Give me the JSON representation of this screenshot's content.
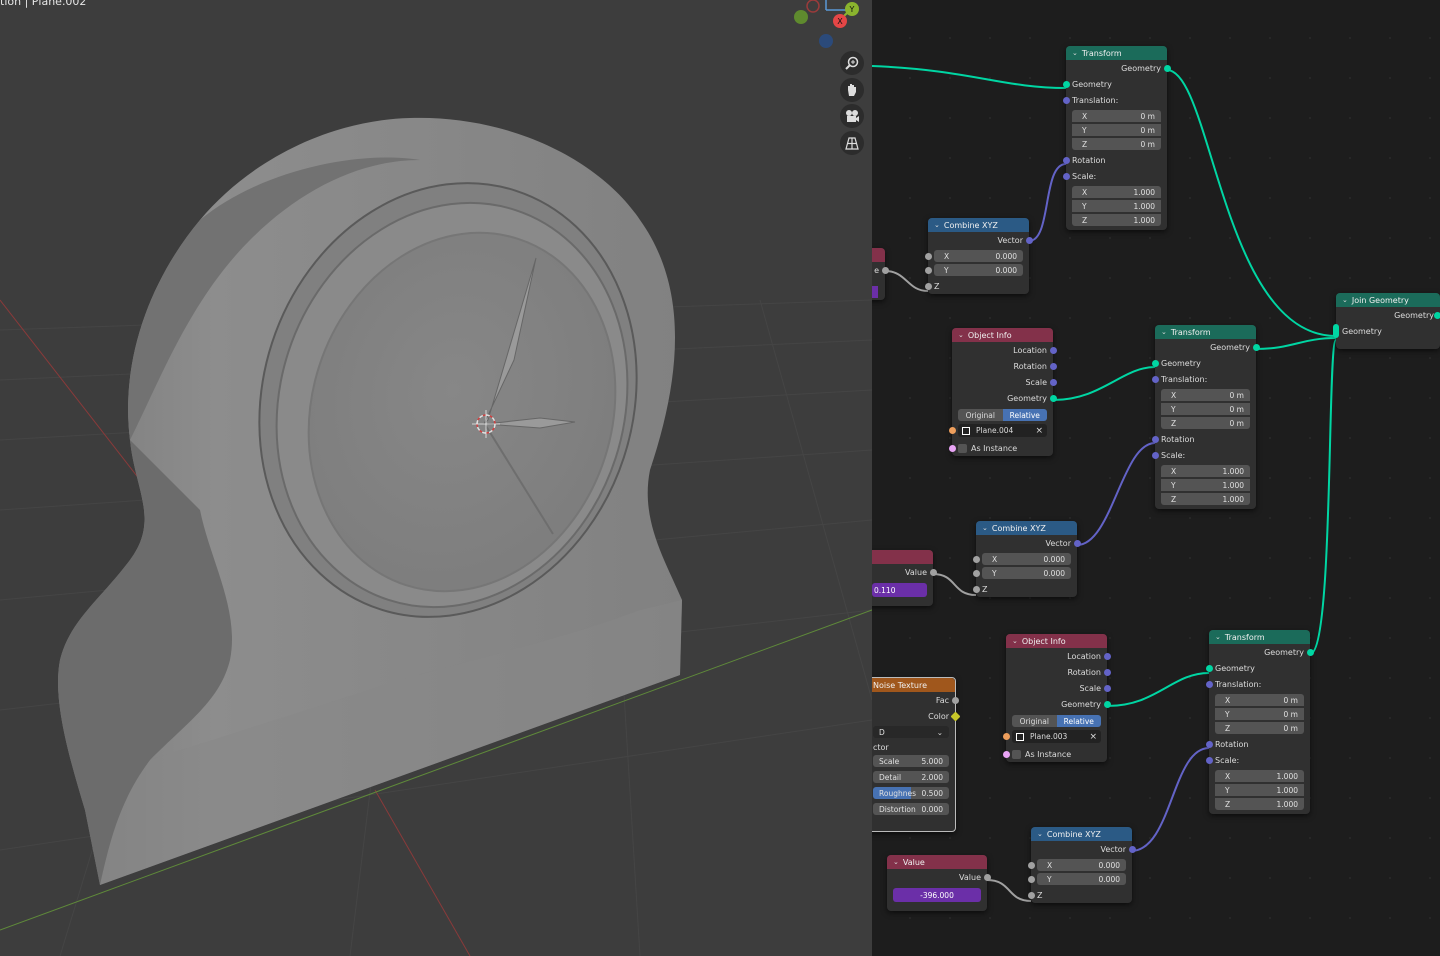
{
  "viewport": {
    "title": "tion | Plane.002",
    "gizmo": {
      "x": "X",
      "y": "Y"
    },
    "tools": [
      {
        "icon": "zoom-icon"
      },
      {
        "icon": "hand-pan-icon"
      },
      {
        "icon": "camera-icon"
      },
      {
        "icon": "grid-view-icon"
      }
    ]
  },
  "colors": {
    "geometry": "#00d6a3",
    "vector": "#6363c7",
    "float": "#a1a1a1",
    "geometry_header": "#1b6b5a",
    "vector_header": "#2b5a85",
    "input_header": "#83314a",
    "texture_header": "#a0571c",
    "accent": "#4772b3",
    "value_field": "#6b2fa8"
  },
  "nodes": {
    "transform1": {
      "title": "Transform",
      "out": "Geometry",
      "in_geometry": "Geometry",
      "translation_label": "Translation:",
      "tx": {
        "k": "X",
        "v": "0 m"
      },
      "ty": {
        "k": "Y",
        "v": "0 m"
      },
      "tz": {
        "k": "Z",
        "v": "0 m"
      },
      "rotation": "Rotation",
      "scale_label": "Scale:",
      "sx": {
        "k": "X",
        "v": "1.000"
      },
      "sy": {
        "k": "Y",
        "v": "1.000"
      },
      "sz": {
        "k": "Z",
        "v": "1.000"
      }
    },
    "transform2": {
      "title": "Transform",
      "out": "Geometry",
      "in_geometry": "Geometry",
      "translation_label": "Translation:",
      "tx": {
        "k": "X",
        "v": "0 m"
      },
      "ty": {
        "k": "Y",
        "v": "0 m"
      },
      "tz": {
        "k": "Z",
        "v": "0 m"
      },
      "rotation": "Rotation",
      "scale_label": "Scale:",
      "sx": {
        "k": "X",
        "v": "1.000"
      },
      "sy": {
        "k": "Y",
        "v": "1.000"
      },
      "sz": {
        "k": "Z",
        "v": "1.000"
      }
    },
    "transform3": {
      "title": "Transform",
      "out": "Geometry",
      "in_geometry": "Geometry",
      "translation_label": "Translation:",
      "tx": {
        "k": "X",
        "v": "0 m"
      },
      "ty": {
        "k": "Y",
        "v": "0 m"
      },
      "tz": {
        "k": "Z",
        "v": "0 m"
      },
      "rotation": "Rotation",
      "scale_label": "Scale:",
      "sx": {
        "k": "X",
        "v": "1.000"
      },
      "sy": {
        "k": "Y",
        "v": "1.000"
      },
      "sz": {
        "k": "Z",
        "v": "1.000"
      }
    },
    "combine1": {
      "title": "Combine XYZ",
      "out": "Vector",
      "x": {
        "k": "X",
        "v": "0.000"
      },
      "y": {
        "k": "Y",
        "v": "0.000"
      },
      "z": "Z"
    },
    "combine2": {
      "title": "Combine XYZ",
      "out": "Vector",
      "x": {
        "k": "X",
        "v": "0.000"
      },
      "y": {
        "k": "Y",
        "v": "0.000"
      },
      "z": "Z"
    },
    "combine3": {
      "title": "Combine XYZ",
      "out": "Vector",
      "x": {
        "k": "X",
        "v": "0.000"
      },
      "y": {
        "k": "Y",
        "v": "0.000"
      },
      "z": "Z"
    },
    "objinfo1": {
      "title": "Object Info",
      "location": "Location",
      "rotation": "Rotation",
      "scale": "Scale",
      "geometry": "Geometry",
      "opt_original": "Original",
      "opt_relative": "Relative",
      "object": "Plane.004",
      "as_instance": "As Instance"
    },
    "objinfo2": {
      "title": "Object Info",
      "location": "Location",
      "rotation": "Rotation",
      "scale": "Scale",
      "geometry": "Geometry",
      "opt_original": "Original",
      "opt_relative": "Relative",
      "object": "Plane.003",
      "as_instance": "As Instance"
    },
    "join": {
      "title": "Join Geometry",
      "out": "Geometry",
      "in": "Geometry"
    },
    "partial1": {
      "label": "e"
    },
    "value_partial": {
      "out": "Value",
      "value": "0.110"
    },
    "value": {
      "title": "Value",
      "out": "Value",
      "value": "-396.000"
    },
    "noise": {
      "title": "Noise Texture",
      "fac": "Fac",
      "color": "Color",
      "dims": "D",
      "vector": "ctor",
      "scale": {
        "k": "Scale",
        "v": "5.000"
      },
      "detail": {
        "k": "Detail",
        "v": "2.000"
      },
      "roughness": {
        "k": "Roughnes",
        "v": "0.500"
      },
      "distortion": {
        "k": "Distortion",
        "v": "0.000"
      }
    }
  }
}
